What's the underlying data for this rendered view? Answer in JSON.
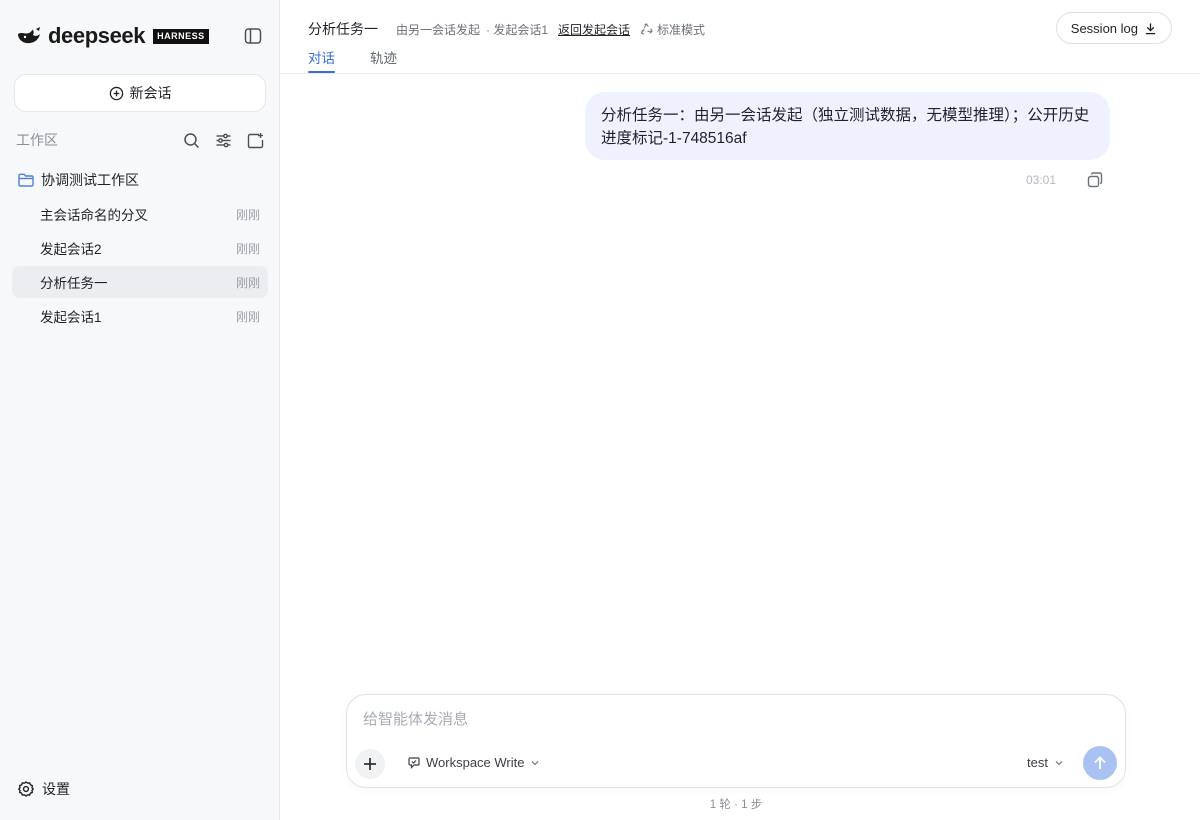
{
  "sidebar": {
    "logo_text": "deepseek",
    "logo_badge": "HARNESS",
    "new_chat_label": "新会话",
    "workspace_title": "工作区",
    "folder_name": "协调测试工作区",
    "conversations": [
      {
        "title": "主会话命名的分叉",
        "time": "刚刚",
        "active": false
      },
      {
        "title": "发起会话2",
        "time": "刚刚",
        "active": false
      },
      {
        "title": "分析任务一",
        "time": "刚刚",
        "active": true
      },
      {
        "title": "发起会话1",
        "time": "刚刚",
        "active": false
      }
    ],
    "settings_label": "设置"
  },
  "header": {
    "conversation_name": "分析任务一",
    "origin_text": "由另一会话发起",
    "origin_parent": "· 发起会话1",
    "back_link": "返回发起会话",
    "mode_label": "标准模式",
    "session_log_label": "Session log",
    "tabs": [
      {
        "label": "对话",
        "active": true
      },
      {
        "label": "轨迹",
        "active": false
      }
    ]
  },
  "messages": [
    {
      "role": "user",
      "text": "分析任务一：由另一会话发起（独立测试数据，无模型推理）；公开历史进度标记-1-748516af",
      "time": "03:01"
    }
  ],
  "composer": {
    "placeholder": "给智能体发消息",
    "value": "",
    "permission_label": "Workspace Write",
    "model_label": "test"
  },
  "footer": {
    "turn_count": "1 轮 · 1 步"
  },
  "colors": {
    "accent": "#3b6fd6",
    "bubble_bg": "#edf2fe",
    "send_button": "#aac2f2",
    "sidebar_bg": "#f7f8fa",
    "folder_icon": "#4f7fdc"
  }
}
